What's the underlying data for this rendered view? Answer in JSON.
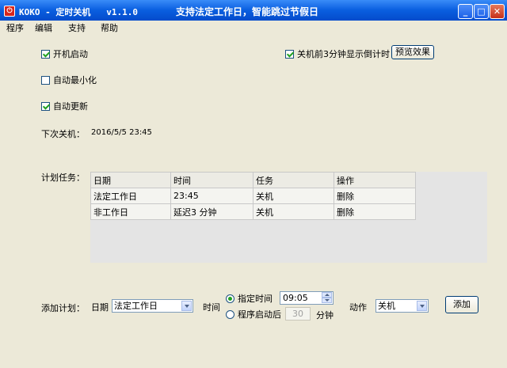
{
  "window": {
    "icon_glyph": "⏻",
    "title": "KOKO - 定时关机   v1.1.0",
    "slogan": "支持法定工作日，智能跳过节假日",
    "min_glyph": "_",
    "max_glyph": "□",
    "close_glyph": "✕"
  },
  "menu": [
    "程序",
    "编辑",
    "支持",
    "帮助"
  ],
  "options": {
    "autostart": "开机启动",
    "autominimize": "自动最小化",
    "autoupdate": "自动更新",
    "countdown": "关机前3分钟显示倒计时",
    "preview_button": "预览效果"
  },
  "next_shutdown": {
    "label": "下次关机：",
    "value": "2016/5/5 23:45"
  },
  "tasks": {
    "label": "计划任务：",
    "columns": [
      "日期",
      "时间",
      "任务",
      "操作"
    ],
    "rows": [
      [
        "法定工作日",
        "23:45",
        "关机",
        "删除"
      ],
      [
        "非工作日",
        "延迟3 分钟",
        "关机",
        "删除"
      ]
    ]
  },
  "add_plan": {
    "label": "添加计划：",
    "date_label": "日期",
    "date_value": "法定工作日",
    "time_label": "时间",
    "radio_specific": "指定时间",
    "time_value": "09:05",
    "radio_after_start": "程序启动后",
    "minutes_value": "30",
    "minutes_unit": "分钟",
    "action_label": "动作",
    "action_value": "关机",
    "add_button": "添加"
  }
}
